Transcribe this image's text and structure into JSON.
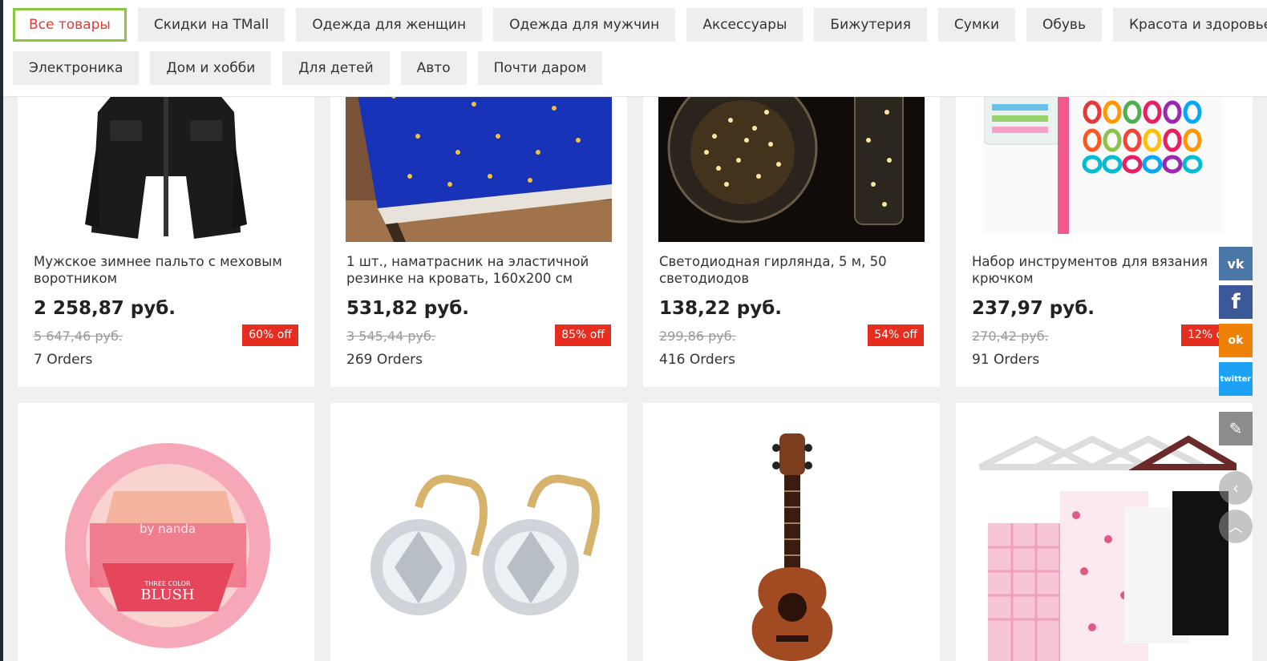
{
  "categories_row1": [
    "Все товары",
    "Скидки на TMall",
    "Одежда для женщин",
    "Одежда для мужчин",
    "Аксессуары",
    "Бижутерия",
    "Сумки",
    "Обувь",
    "Красота и здоровье"
  ],
  "categories_row2": [
    "Электроника",
    "Дом и хобби",
    "Для детей",
    "Авто",
    "Почти даром"
  ],
  "products": [
    {
      "title": "Мужское зимнее пальто с меховым воротником",
      "price": "2 258,87 руб.",
      "old_price": "5 647,46 руб.",
      "discount": "60% off",
      "orders": "7 Orders"
    },
    {
      "title": "1 шт., наматрасник на эластичной резинке на кровать, 160x200 см",
      "price": "531,82 руб.",
      "old_price": "3 545,44 руб.",
      "discount": "85% off",
      "orders": "269 Orders"
    },
    {
      "title": "Светодиодная гирлянда, 5 м, 50 светодиодов",
      "price": "138,22 руб.",
      "old_price": "299,86 руб.",
      "discount": "54% off",
      "orders": "416 Orders"
    },
    {
      "title": "Набор инструментов для вязания крючком",
      "price": "237,97 руб.",
      "old_price": "270,42 руб.",
      "discount": "12% off",
      "orders": "91 Orders"
    }
  ],
  "product_image_text": {
    "blush_brand": "by nanda",
    "blush_sub": "THREE COLOR",
    "blush_main": "BLUSH"
  },
  "social": {
    "vk": "vk",
    "facebook": "f",
    "ok": "ok",
    "twitter": "twitter"
  },
  "colors": {
    "active_border": "#8cc63f",
    "active_text": "#e53935",
    "discount_badge": "#e52e1f",
    "vk": "#4a76a8",
    "facebook": "#3b5998",
    "ok": "#ee8208",
    "twitter": "#1da1f2",
    "edit": "#8c8c8c"
  }
}
